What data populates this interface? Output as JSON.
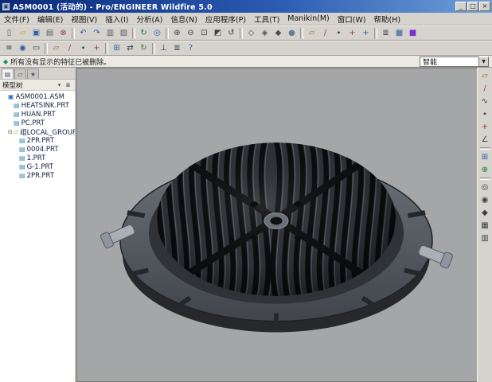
{
  "titlebar": {
    "title": "ASM0001 (活动的) - Pro/ENGINEER Wildfire 5.0",
    "buttons": [
      {
        "name": "minimize-button",
        "glyph": "_"
      },
      {
        "name": "maximize-button",
        "glyph": "□"
      },
      {
        "name": "close-button",
        "glyph": "×"
      }
    ]
  },
  "menubar": {
    "items": [
      {
        "name": "menu-file",
        "label": "文件(F)"
      },
      {
        "name": "menu-edit",
        "label": "编辑(E)"
      },
      {
        "name": "menu-view",
        "label": "视图(V)"
      },
      {
        "name": "menu-insert",
        "label": "插入(I)"
      },
      {
        "name": "menu-analysis",
        "label": "分析(A)"
      },
      {
        "name": "menu-info",
        "label": "信息(N)"
      },
      {
        "name": "menu-applications",
        "label": "应用程序(P)"
      },
      {
        "name": "menu-tools",
        "label": "工具(T)"
      },
      {
        "name": "menu-manikin",
        "label": "Manikin(M)"
      },
      {
        "name": "menu-window",
        "label": "窗口(W)"
      },
      {
        "name": "menu-help",
        "label": "帮助(H)"
      }
    ]
  },
  "toolbar_main": {
    "items": [
      {
        "name": "new-button",
        "glyph": "▯",
        "color": "#5a5f66"
      },
      {
        "name": "open-button",
        "glyph": "▱",
        "color": "#c9972f"
      },
      {
        "name": "save-button",
        "glyph": "▣",
        "color": "#2e5fa3"
      },
      {
        "name": "print-button",
        "glyph": "▤",
        "color": "#5a5f66"
      },
      {
        "name": "erase-not-displayed-button",
        "glyph": "⊗",
        "color": "#8a4040"
      },
      {
        "sep": true
      },
      {
        "name": "undo-button",
        "glyph": "↶",
        "color": "#2e5fa3"
      },
      {
        "name": "redo-button",
        "glyph": "↷",
        "color": "#2e5fa3"
      },
      {
        "name": "copy-button",
        "glyph": "▥",
        "color": "#5a5f66"
      },
      {
        "name": "paste-button",
        "glyph": "▨",
        "color": "#5a5f66"
      },
      {
        "sep": true
      },
      {
        "name": "regenerate-button",
        "glyph": "↻",
        "color": "#1f7a33"
      },
      {
        "name": "find-button",
        "glyph": "◎",
        "color": "#2e5fa3"
      },
      {
        "sep": true
      },
      {
        "name": "zoom-in-button",
        "glyph": "⊕",
        "color": "#3a3f45"
      },
      {
        "name": "zoom-out-button",
        "glyph": "⊖",
        "color": "#3a3f45"
      },
      {
        "name": "refit-button",
        "glyph": "⊡",
        "color": "#3a3f45"
      },
      {
        "name": "repaint-button",
        "glyph": "◩",
        "color": "#3a3f45"
      },
      {
        "name": "reorient-button",
        "glyph": "↺",
        "color": "#3a3f45"
      },
      {
        "sep": true
      },
      {
        "name": "wireframe-button",
        "glyph": "◇",
        "color": "#4a5058"
      },
      {
        "name": "hidden-line-button",
        "glyph": "◈",
        "color": "#4a5058"
      },
      {
        "name": "no-hidden-button",
        "glyph": "◆",
        "color": "#4a5058"
      },
      {
        "name": "shaded-button",
        "glyph": "●",
        "color": "#6a7c95"
      },
      {
        "sep": true
      },
      {
        "name": "datum-plane-toggle",
        "glyph": "▱",
        "color": "#9a6f2f"
      },
      {
        "name": "datum-axis-toggle",
        "glyph": "∕",
        "color": "#9a3a3a"
      },
      {
        "name": "datum-point-toggle",
        "glyph": "∙",
        "color": "#3a3f45"
      },
      {
        "name": "csys-toggle",
        "glyph": "+",
        "color": "#9a3a3a"
      },
      {
        "name": "spin-center-toggle",
        "glyph": "+",
        "color": "#2e5fa3"
      },
      {
        "sep": true
      },
      {
        "name": "layer-button",
        "glyph": "≣",
        "color": "#3a3f45"
      },
      {
        "name": "view-manager-button",
        "glyph": "▦",
        "color": "#2e5fa3"
      },
      {
        "name": "render-button",
        "glyph": "■",
        "color": "#7a2fd0"
      }
    ]
  },
  "toolbar_secondary": {
    "items": [
      {
        "name": "model-tree-toggle-button",
        "glyph": "≡",
        "color": "#3a3f45"
      },
      {
        "name": "info-button",
        "glyph": "◉",
        "color": "#2e5fa3"
      },
      {
        "name": "annotation-button",
        "glyph": "▭",
        "color": "#3a3f45"
      },
      {
        "sep": true
      },
      {
        "name": "plane-display-button",
        "glyph": "▱",
        "color": "#9a6f2f"
      },
      {
        "name": "axis-display-button",
        "glyph": "∕",
        "color": "#9a3a3a"
      },
      {
        "name": "point-display-button",
        "glyph": "∙",
        "color": "#3a3f45"
      },
      {
        "name": "csys-display-button",
        "glyph": "+",
        "color": "#9a3a3a"
      },
      {
        "sep": true
      },
      {
        "name": "component-placement-button",
        "glyph": "⊞",
        "color": "#2e5fa3"
      },
      {
        "name": "drag-component-button",
        "glyph": "⇄",
        "color": "#3a3f45"
      },
      {
        "name": "regenerate-manager-button",
        "glyph": "↻",
        "color": "#1f7a33"
      },
      {
        "sep": true
      },
      {
        "name": "view-normal-button",
        "glyph": "⊥",
        "color": "#3a3f45"
      },
      {
        "name": "settings-button",
        "glyph": "≣",
        "color": "#3a3f45"
      },
      {
        "name": "help-button",
        "glyph": "?",
        "color": "#2e5fa3"
      }
    ]
  },
  "message": {
    "glyph": "◆",
    "text": "所有没有显示的特征已被删除。"
  },
  "filter_combo": {
    "value": "智能"
  },
  "navigator": {
    "tabs": [
      {
        "name": "tab-model-tree",
        "glyph": "▤",
        "active": true
      },
      {
        "name": "tab-folder-browser",
        "glyph": "▱"
      },
      {
        "name": "tab-favorites",
        "glyph": "★"
      }
    ],
    "header": {
      "title": "模型树"
    },
    "header_buttons": [
      {
        "name": "tree-show-dropdown-button",
        "glyph": "▾"
      },
      {
        "name": "tree-settings-dropdown-button",
        "glyph": "≣"
      }
    ],
    "tree": [
      {
        "name": "tree-item-asm0001",
        "label": "ASM0001.ASM",
        "icon": "assembly-icon",
        "glyph": "▣",
        "color": "#2e6db0",
        "level": 0
      },
      {
        "name": "tree-item-heatsink",
        "label": "HEATSINK.PRT",
        "icon": "part-icon",
        "glyph": "▤",
        "color": "#3a8ab0",
        "level": 1
      },
      {
        "name": "tree-item-huan",
        "label": "HUAN.PRT",
        "icon": "part-icon",
        "glyph": "▤",
        "color": "#3a8ab0",
        "level": 1
      },
      {
        "name": "tree-item-pc",
        "label": "PC.PRT",
        "icon": "part-icon",
        "glyph": "▤",
        "color": "#3a8ab0",
        "level": 1
      },
      {
        "name": "tree-item-local-group",
        "label": "组LOCAL_GROUP",
        "icon": "group-icon",
        "glyph": "▱",
        "color": "#c9972f",
        "level": 1,
        "expander": "⊟"
      },
      {
        "name": "tree-item-2pr-1",
        "label": "2PR.PRT",
        "icon": "part-icon",
        "glyph": "▤",
        "color": "#3a8ab0",
        "level": 2
      },
      {
        "name": "tree-item-0004",
        "label": "0004.PRT",
        "icon": "part-icon",
        "glyph": "▤",
        "color": "#3a8ab0",
        "level": 2
      },
      {
        "name": "tree-item-1",
        "label": "1.PRT",
        "icon": "part-icon",
        "glyph": "▤",
        "color": "#3a8ab0",
        "level": 2
      },
      {
        "name": "tree-item-g1",
        "label": "G-1.PRT",
        "icon": "part-icon",
        "glyph": "▤",
        "color": "#3a8ab0",
        "level": 2
      },
      {
        "name": "tree-item-2pr-2",
        "label": "2PR.PRT",
        "icon": "part-icon",
        "glyph": "▤",
        "color": "#3a8ab0",
        "level": 2
      }
    ]
  },
  "right_toolbar": {
    "items": [
      {
        "name": "datum-plane-tool",
        "glyph": "▱",
        "color": "#9a6f2f"
      },
      {
        "name": "datum-axis-tool",
        "glyph": "∕",
        "color": "#9a3a3a"
      },
      {
        "name": "datum-curve-tool",
        "glyph": "∿",
        "color": "#3a3f45"
      },
      {
        "name": "datum-point-tool",
        "glyph": "∙",
        "color": "#3a3f45"
      },
      {
        "name": "csys-tool",
        "glyph": "+",
        "color": "#9a3a3a"
      },
      {
        "name": "sketch-tool",
        "glyph": "∠",
        "color": "#3a3f45"
      },
      {
        "sep": true
      },
      {
        "name": "assemble-component-tool",
        "glyph": "⊞",
        "color": "#2e5fa3"
      },
      {
        "name": "create-component-tool",
        "glyph": "⊕",
        "color": "#1f7a33"
      },
      {
        "sep": true
      },
      {
        "name": "hole-tool",
        "glyph": "◎",
        "color": "#3a3f45"
      },
      {
        "name": "round-tool",
        "glyph": "◉",
        "color": "#3a3f45"
      },
      {
        "name": "chamfer-tool",
        "glyph": "◆",
        "color": "#3a3f45"
      },
      {
        "name": "pattern-tool",
        "glyph": "▦",
        "color": "#3a3f45"
      },
      {
        "name": "mirror-tool",
        "glyph": "▥",
        "color": "#3a3f45"
      }
    ]
  },
  "viewport": {
    "background": "#a4a6a8",
    "model_colors": {
      "flange": "#565b62",
      "fin_groove": "#0b0c0e",
      "fin_ridge": "#2e3237",
      "fin_highlight": "#59606a",
      "clip": "#a9afb6"
    }
  }
}
